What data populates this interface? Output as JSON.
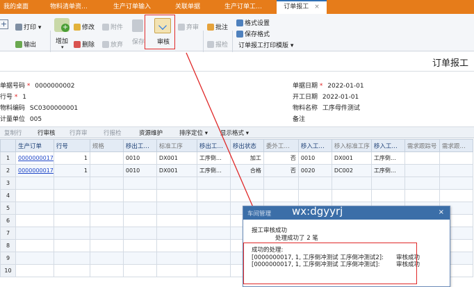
{
  "tabs": [
    {
      "label": "我的桌面"
    },
    {
      "label": "物料清单资…"
    },
    {
      "label": "生产订单输入"
    },
    {
      "label": "关联单据"
    },
    {
      "label": "生产订单工…"
    },
    {
      "label": "订单报工",
      "close": "×"
    }
  ],
  "ribbon": {
    "print": "打印",
    "export": "输出",
    "add": "增加",
    "edit": "修改",
    "attach": "附件",
    "delete": "删除",
    "abandon": "放弃",
    "save": "保存",
    "audit": "审核",
    "discard": "弃审",
    "annotate": "批注",
    "report": "报检",
    "format_settings": "格式设置",
    "save_format": "保存格式",
    "print_template": "订单报工打印模版"
  },
  "page_title": "订单报工",
  "form": {
    "doc_no_label": "单据号码",
    "doc_no": "0000000002",
    "line_no_label": "行号",
    "line_no": "1",
    "material_code_label": "物料编码",
    "material_code": "SC0300000001",
    "unit_label": "计量单位",
    "unit": "005",
    "doc_date_label": "单据日期",
    "doc_date": "2022-01-01",
    "start_date_label": "开工日期",
    "start_date": "2022-01-01",
    "material_name_label": "物料名称",
    "material_name": "工序母件测试",
    "remark_label": "备注"
  },
  "toolbar2": {
    "copy_row": "复制行",
    "row_audit": "行审核",
    "row_discard": "行弃审",
    "row_inspect": "行报检",
    "resource": "资源维护",
    "sort": "排序定位",
    "display": "显示格式"
  },
  "grid": {
    "headers": [
      "生产订单",
      "行号",
      "规格",
      "移出工…",
      "标准工序",
      "移出工…",
      "移出状态",
      "委外工…",
      "移入工…",
      "移入标准工序",
      "移入工…",
      "需求跟踪号",
      "需求跟…"
    ],
    "rows": [
      {
        "rn": "1",
        "order": "0000000017",
        "line": "1",
        "spec": "",
        "out_op": "0010",
        "std_op": "DX001",
        "out_name": "工序倒…",
        "status": "加工",
        "outsrc": "否",
        "in_op": "0010",
        "in_std": "DX001",
        "in_name": "工序倒…"
      },
      {
        "rn": "2",
        "order": "0000000017",
        "line": "1",
        "spec": "",
        "out_op": "0010",
        "std_op": "DX001",
        "out_name": "工序倒…",
        "status": "合格",
        "outsrc": "否",
        "in_op": "0020",
        "in_std": "DC002",
        "in_name": "工序倒…"
      }
    ],
    "empty_rows": [
      "3",
      "4",
      "5",
      "6",
      "7",
      "8",
      "9",
      "10"
    ]
  },
  "dialog": {
    "title": "车间管理",
    "watermark": "wx:dgyyrj",
    "close": "×",
    "line1": "报工审核成功",
    "line2": "处理成功了 2 笔",
    "success_header": "成功的处理:",
    "result1": "[0000000017, 1, 工序倒冲测试 工序倒冲测试2]:",
    "status1": "审核成功",
    "result2": "[0000000017, 1, 工序倒冲测试 工序倒冲测试]:",
    "status2": "审核成功"
  },
  "colors": {
    "tab_orange": "#e67c1a",
    "highlight_red": "#e02828",
    "dialog_blue": "#3b6ea8",
    "link_blue": "#1e46c8"
  }
}
